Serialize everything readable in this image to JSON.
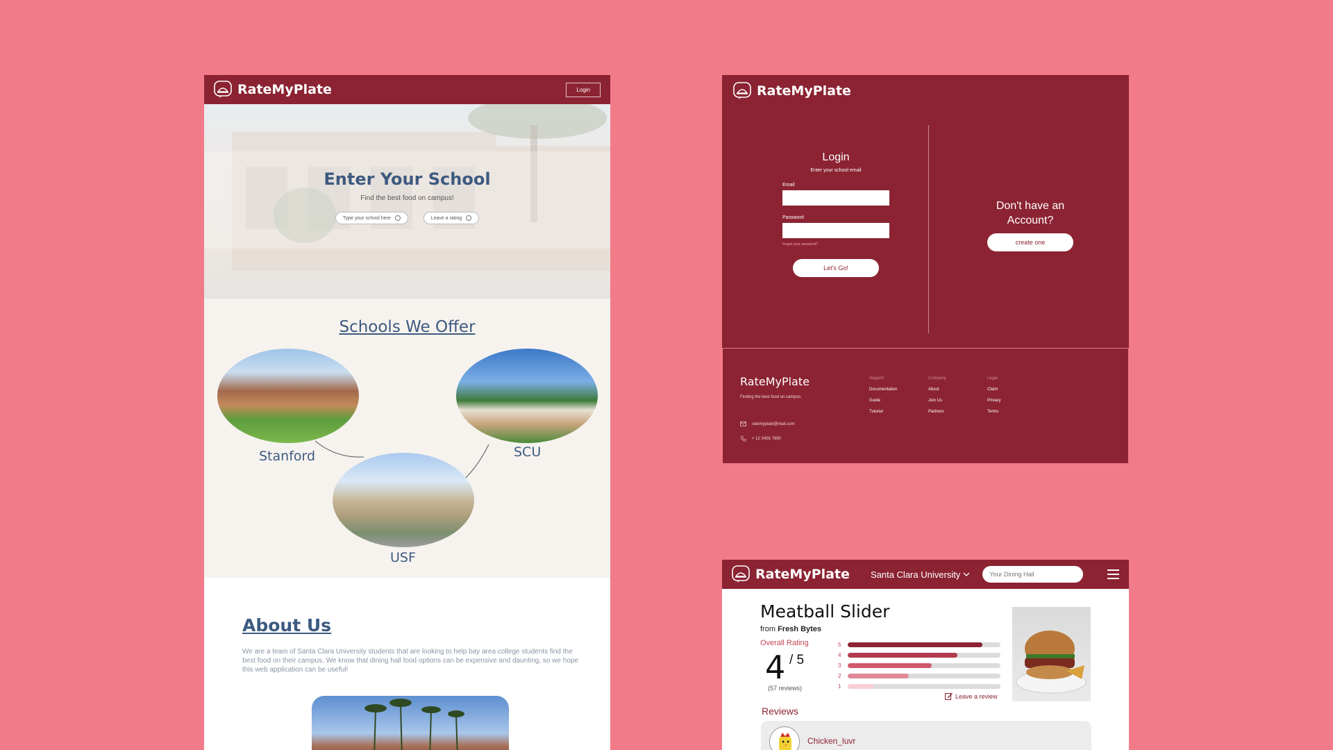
{
  "brand": {
    "name": "RateMyPlate"
  },
  "home": {
    "nav": {
      "login_label": "Login"
    },
    "hero": {
      "title": "Enter Your School",
      "subtitle": "Find the best food on campus!",
      "school_input_placeholder": "Type your school here",
      "rating_button": "Leave a rating"
    },
    "schools": {
      "title": "Schools We Offer",
      "items": [
        {
          "name": "Stanford"
        },
        {
          "name": "SCU"
        },
        {
          "name": "USF"
        }
      ]
    },
    "about": {
      "title": "About Us",
      "text": "We are a team of Santa Clara University students that are looking to help bay area college students find the best food on their campus. We know that dining hall food options can be expensive and daunting, so we hope this web application can be useful!"
    }
  },
  "login": {
    "title": "Login",
    "subtitle": "Enter your school email",
    "email_label": "Email",
    "password_label": "Password",
    "forgot_label": "Forgot your password?",
    "submit_label": "Let's Go!",
    "no_account": "Don't have an Account?",
    "create_label": "create one"
  },
  "footer": {
    "brand": "RateMyPlate",
    "tagline": "Finding the best food on campus.",
    "email": "ratemyplate@mail.com",
    "phone": "+ 12 3456 7890",
    "columns": [
      {
        "title": "Support",
        "items": [
          "Documentation",
          "Guide",
          "Tutorial"
        ]
      },
      {
        "title": "Company",
        "items": [
          "About",
          "Join Us",
          "Partners"
        ]
      },
      {
        "title": "Legal",
        "items": [
          "Claim",
          "Privacy",
          "Terms"
        ]
      }
    ]
  },
  "food": {
    "school_select": "Santa Clara University",
    "dining_hall_placeholder": "Your Dining Hall",
    "dish": "Meatball Slider",
    "from_prefix": "from",
    "location": "Fresh Bytes",
    "overall_label": "Overall Rating",
    "score": "4",
    "out_of": "/ 5",
    "review_count": "(57 reviews)",
    "distribution": [
      {
        "star": "5",
        "fraction": 0.88,
        "color": "#8b2332"
      },
      {
        "star": "4",
        "fraction": 0.72,
        "color": "#b23a4d"
      },
      {
        "star": "3",
        "fraction": 0.55,
        "color": "#cf5a6c"
      },
      {
        "star": "2",
        "fraction": 0.4,
        "color": "#e08a97"
      },
      {
        "star": "1",
        "fraction": 0.17,
        "color": "#f6cfd5"
      }
    ],
    "leave_review": "Leave a review",
    "reviews_title": "Reviews",
    "reviewer": "Chicken_luvr"
  },
  "colors": {
    "background": "#f27b8a",
    "brand": "#8b2332",
    "accent_blue": "#3d5a80"
  },
  "icons": [
    "plate-logo-icon",
    "info-icon",
    "chevron-down-icon",
    "menu-icon",
    "edit-icon",
    "mail-icon",
    "phone-icon"
  ]
}
